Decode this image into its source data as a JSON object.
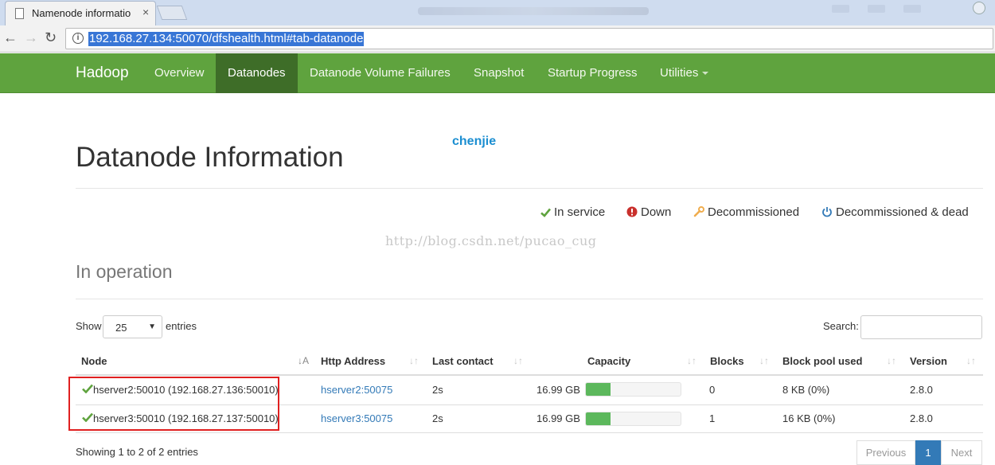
{
  "browser": {
    "tab_title": "Namenode informatio",
    "tab_close": "×",
    "url": "192.168.27.134:50070/dfshealth.html#tab-datanode",
    "back": "←",
    "forward": "→",
    "reload": "↻",
    "info": "i"
  },
  "navbar": {
    "brand": "Hadoop",
    "items": [
      {
        "label": "Overview"
      },
      {
        "label": "Datanodes"
      },
      {
        "label": "Datanode Volume Failures"
      },
      {
        "label": "Snapshot"
      },
      {
        "label": "Startup Progress"
      },
      {
        "label": "Utilities"
      }
    ]
  },
  "page": {
    "title": "Datanode Information",
    "user_note": "chenjie",
    "watermark": "http://blog.csdn.net/pucao_cug",
    "section_title": "In operation"
  },
  "legend": {
    "in_service": "In service",
    "down": "Down",
    "decommissioned": "Decommissioned",
    "decommissioned_dead": "Decommissioned & dead",
    "colors": {
      "in_service": "#5fa33e",
      "down": "#c9302c",
      "decommissioned": "#f0ad4e",
      "decommissioned_dead": "#337ab7"
    }
  },
  "controls": {
    "show_label": "Show",
    "page_length": "25",
    "entries_label": "entries",
    "search_label": "Search:"
  },
  "table": {
    "columns": [
      "Node",
      "Http Address",
      "Last contact",
      "Capacity",
      "Blocks",
      "Block pool used",
      "Version"
    ],
    "rows": [
      {
        "node": "hserver2:50010 (192.168.27.136:50010)",
        "http": "hserver2:50075",
        "last_contact": "2s",
        "capacity": "16.99 GB",
        "used_fraction": 0.26,
        "blocks": "0",
        "pool_used": "8 KB (0%)",
        "version": "2.8.0"
      },
      {
        "node": "hserver3:50010 (192.168.27.137:50010)",
        "http": "hserver3:50075",
        "last_contact": "2s",
        "capacity": "16.99 GB",
        "used_fraction": 0.26,
        "blocks": "1",
        "pool_used": "16 KB (0%)",
        "version": "2.8.0"
      }
    ]
  },
  "footer": {
    "info": "Showing 1 to 2 of 2 entries",
    "previous": "Previous",
    "page": "1",
    "next": "Next"
  }
}
